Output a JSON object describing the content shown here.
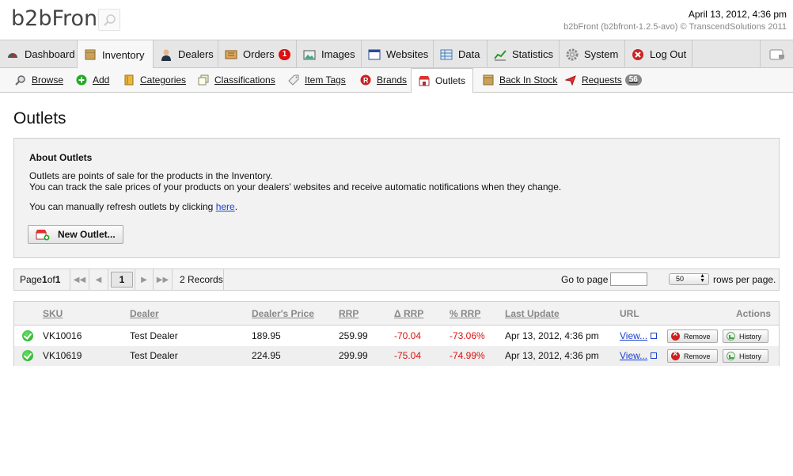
{
  "header": {
    "logo": "b2bFront",
    "datetime": "April 13, 2012, 4:36 pm",
    "version": "b2bFront (b2bfront-1.2.5-avo) © TranscendSolutions 2011"
  },
  "main_nav": {
    "tabs": [
      {
        "label": "Dashboard",
        "icon": "dashboard-icon"
      },
      {
        "label": "Inventory",
        "icon": "box-icon"
      },
      {
        "label": "Dealers",
        "icon": "person-icon"
      },
      {
        "label": "Orders",
        "icon": "orders-icon",
        "badge": "1"
      },
      {
        "label": "Images",
        "icon": "images-icon"
      },
      {
        "label": "Websites",
        "icon": "window-icon"
      },
      {
        "label": "Data",
        "icon": "data-icon"
      },
      {
        "label": "Statistics",
        "icon": "chart-icon"
      },
      {
        "label": "System",
        "icon": "gear-icon"
      },
      {
        "label": "Log Out",
        "icon": "logout-icon"
      }
    ]
  },
  "sub_nav": {
    "tabs": [
      {
        "label": "Browse",
        "icon": "magnifier-icon"
      },
      {
        "label": "Add",
        "icon": "add-icon"
      },
      {
        "label": "Categories",
        "icon": "folder-icon"
      },
      {
        "label": "Classifications",
        "icon": "stack-icon"
      },
      {
        "label": "Item Tags",
        "icon": "tag-icon"
      },
      {
        "label": "Brands",
        "icon": "brand-icon"
      },
      {
        "label": "Outlets",
        "icon": "shop-icon"
      },
      {
        "label": "Back In Stock",
        "icon": "box-icon"
      },
      {
        "label": "Requests",
        "icon": "plane-icon",
        "badge": "56"
      }
    ]
  },
  "page": {
    "title": "Outlets",
    "about_title": "About Outlets",
    "about_line1": "Outlets are points of sale for the products in the Inventory.",
    "about_line2": "You can track the sale prices of your products on your dealers' websites and receive automatic notifications when they change.",
    "refresh_text": "You can manually refresh outlets by clicking ",
    "refresh_link": "here",
    "refresh_end": ".",
    "new_button": "New Outlet..."
  },
  "pager": {
    "page_prefix": "Page ",
    "page_current": "1",
    "page_of": " of ",
    "page_total": "1",
    "current_page_button": "1",
    "records": "2 Records",
    "goto_label": "Go to page",
    "rows_value": "50",
    "rows_label": "rows per page."
  },
  "table": {
    "columns": [
      "SKU",
      "Dealer",
      "Dealer's Price",
      "RRP",
      "Δ RRP",
      "% RRP",
      "Last Update",
      "URL",
      "Actions"
    ],
    "rows": [
      {
        "sku": "VK10016",
        "dealer": "Test Dealer",
        "price": "189.95",
        "rrp": "259.99",
        "delta": "-70.04",
        "pct": "-73.06%",
        "updated": "Apr 13, 2012, 4:36 pm",
        "url": "View...",
        "remove": "Remove",
        "history": "History"
      },
      {
        "sku": "VK10619",
        "dealer": "Test Dealer",
        "price": "224.95",
        "rrp": "299.99",
        "delta": "-75.04",
        "pct": "-74.99%",
        "updated": "Apr 13, 2012, 4:36 pm",
        "url": "View...",
        "remove": "Remove",
        "history": "History"
      }
    ]
  },
  "colors": {
    "accent_red": "#dd1111",
    "link_blue": "#1a3fcf",
    "nav_bg": "#e6e6e6"
  }
}
